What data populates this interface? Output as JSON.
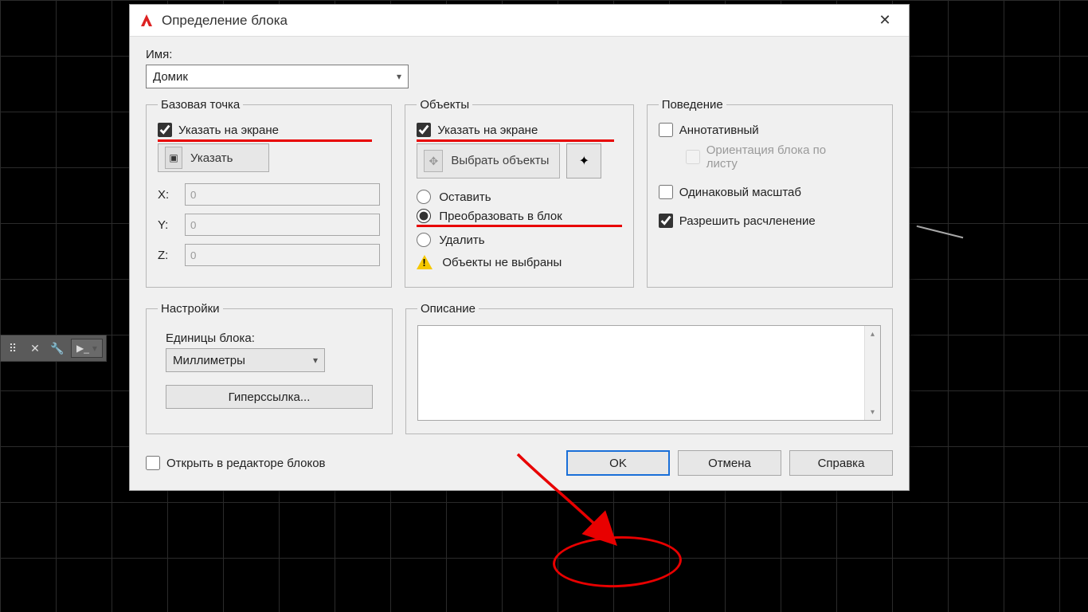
{
  "dialog": {
    "title": "Определение блока",
    "name_label": "Имя:",
    "name_value": "Домик",
    "base_point": {
      "legend": "Базовая точка",
      "specify_on_screen": "Указать на экране",
      "pick_label": "Указать",
      "x_label": "X:",
      "y_label": "Y:",
      "z_label": "Z:",
      "x_value": "0",
      "y_value": "0",
      "z_value": "0"
    },
    "objects": {
      "legend": "Объекты",
      "specify_on_screen": "Указать на экране",
      "select_btn": "Выбрать объекты",
      "retain": "Оставить",
      "convert": "Преобразовать в блок",
      "delete": "Удалить",
      "none_selected": "Объекты не выбраны"
    },
    "behavior": {
      "legend": "Поведение",
      "annotative": "Аннотативный",
      "match_orient": "Ориентация блока по листу",
      "uniform_scale": "Одинаковый масштаб",
      "allow_explode": "Разрешить расчленение"
    },
    "settings": {
      "legend": "Настройки",
      "units_label": "Единицы блока:",
      "units_value": "Миллиметры",
      "hyperlink": "Гиперссылка..."
    },
    "description": {
      "legend": "Описание",
      "value": ""
    },
    "open_in_editor": "Открыть в редакторе блоков",
    "ok": "OK",
    "cancel": "Отмена",
    "help": "Справка"
  },
  "state": {
    "base_point_specify_checked": true,
    "objects_specify_checked": true,
    "objects_radio": "convert",
    "annotative_checked": false,
    "uniform_scale_checked": false,
    "allow_explode_checked": true,
    "open_in_editor_checked": false
  }
}
